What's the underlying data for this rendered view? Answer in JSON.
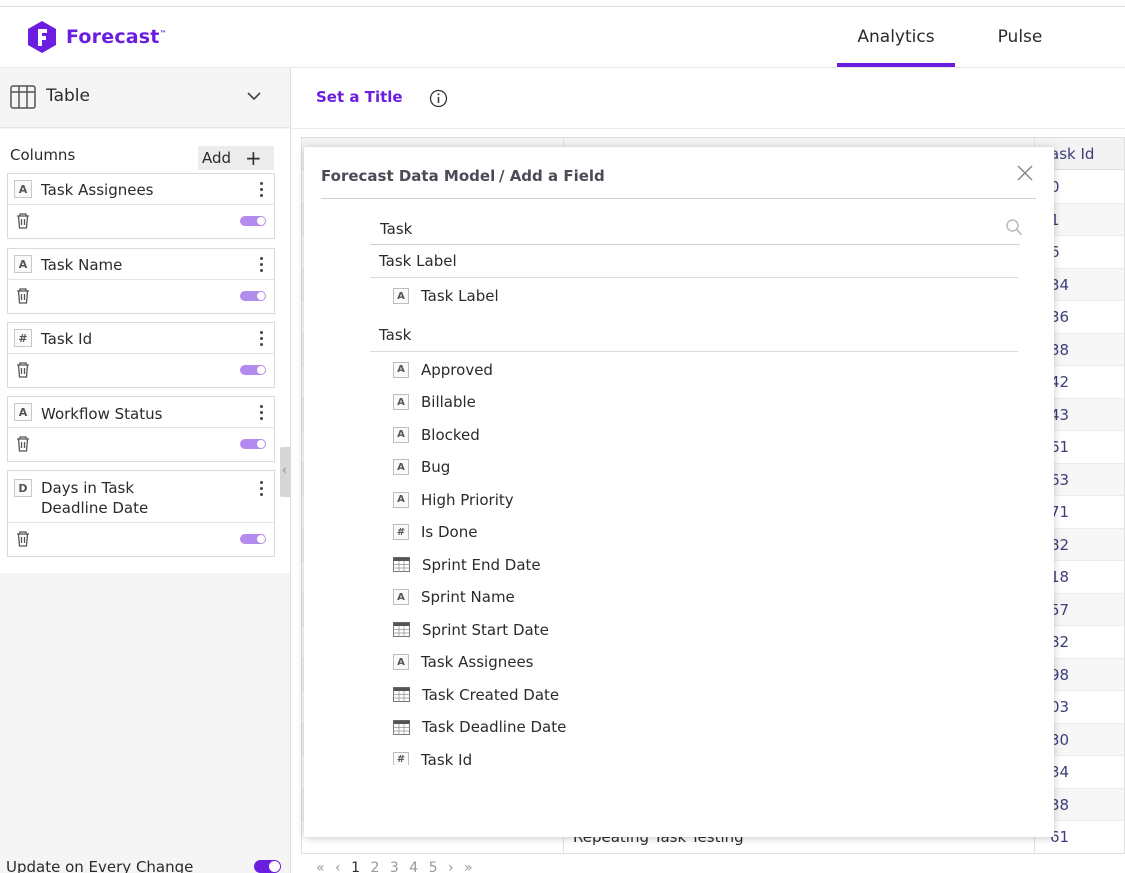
{
  "app": {
    "name": "Forecast"
  },
  "nav": {
    "tabs": [
      {
        "label": "Analytics",
        "active": true
      },
      {
        "label": "Pulse",
        "active": false
      }
    ]
  },
  "sidebar": {
    "viz_type": "Table",
    "columns_label": "Columns",
    "add_label": "Add",
    "columns": [
      {
        "type": "A",
        "name": "Task Assignees",
        "enabled": true
      },
      {
        "type": "A",
        "name": "Task Name",
        "enabled": true
      },
      {
        "type": "#",
        "name": "Task Id",
        "enabled": true
      },
      {
        "type": "A",
        "name": "Workflow Status",
        "enabled": true
      },
      {
        "type": "D",
        "name": "Days in Task Deadline Date",
        "name_line1": "Days in Task",
        "name_line2": "Deadline Date",
        "enabled": true
      }
    ],
    "update_label": "Update on Every Change",
    "update_enabled": true
  },
  "main": {
    "title_placeholder": "Set a Title",
    "table": {
      "header_task_id": "ask Id",
      "visible_name": "Repeating Task Testing",
      "ids": [
        "0",
        "1",
        "6",
        "34",
        "36",
        "38",
        "42",
        "43",
        "61",
        "63",
        "71",
        "82",
        "18",
        "57",
        "82",
        "98",
        "03",
        "30",
        "34",
        "38",
        "61"
      ]
    },
    "pager": {
      "first": "«",
      "prev": "‹",
      "pages": [
        "1",
        "2",
        "3",
        "4",
        "5"
      ],
      "current": "1",
      "next": "›",
      "last": "»"
    }
  },
  "modal": {
    "title": "Forecast Data Model",
    "subtitle": "/ Add a Field",
    "search_value": "Task",
    "groups": [
      {
        "label": "Task Label",
        "fields": [
          {
            "type": "A",
            "name": "Task Label"
          }
        ]
      },
      {
        "label": "Task",
        "fields": [
          {
            "type": "A",
            "name": "Approved"
          },
          {
            "type": "A",
            "name": "Billable"
          },
          {
            "type": "A",
            "name": "Blocked"
          },
          {
            "type": "A",
            "name": "Bug"
          },
          {
            "type": "A",
            "name": "High Priority"
          },
          {
            "type": "#",
            "name": "Is Done"
          },
          {
            "type": "date",
            "name": "Sprint End Date"
          },
          {
            "type": "A",
            "name": "Sprint Name"
          },
          {
            "type": "date",
            "name": "Sprint Start Date"
          },
          {
            "type": "A",
            "name": "Task Assignees"
          },
          {
            "type": "date",
            "name": "Task Created Date"
          },
          {
            "type": "date",
            "name": "Task Deadline Date"
          },
          {
            "type": "#",
            "name": "Task Id"
          }
        ]
      }
    ]
  },
  "colors": {
    "brand": "#6b1de0",
    "toggle_on_light": "#b38bee"
  }
}
